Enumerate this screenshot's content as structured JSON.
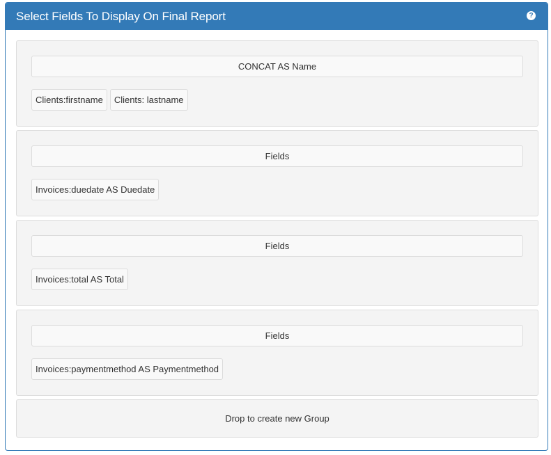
{
  "panel": {
    "title": "Select Fields To Display On Final Report",
    "help_icon": "question-circle-icon"
  },
  "groups": [
    {
      "header": "CONCAT AS Name",
      "fields": [
        "Clients:firstname",
        "Clients: lastname"
      ]
    },
    {
      "header": "Fields",
      "fields": [
        "Invoices:duedate AS Duedate"
      ]
    },
    {
      "header": "Fields",
      "fields": [
        "Invoices:total AS Total"
      ]
    },
    {
      "header": "Fields",
      "fields": [
        "Invoices:paymentmethod AS Paymentmethod"
      ]
    }
  ],
  "drop_zone": {
    "label": "Drop to create new Group"
  },
  "colors": {
    "primary": "#337ab7",
    "group_bg": "#f4f4f4",
    "chip_bg": "#f9f9f9"
  }
}
